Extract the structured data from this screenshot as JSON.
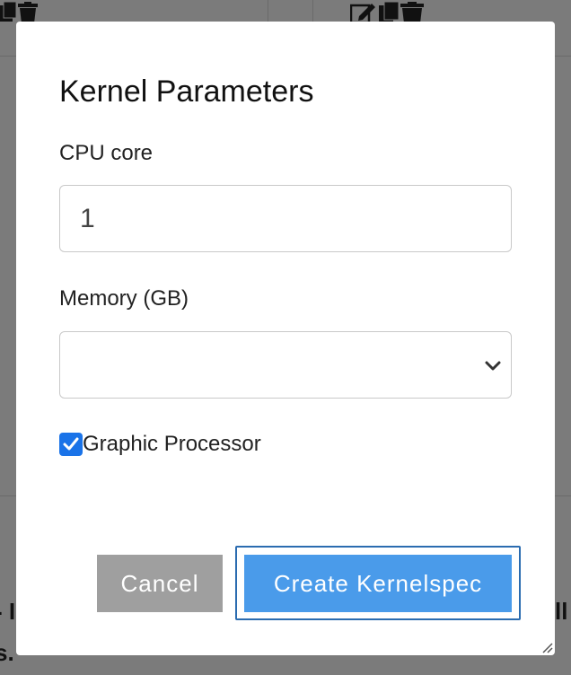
{
  "background": {
    "fragment_left": "- I",
    "fragment_left_2": "s.",
    "fragment_right": "ll"
  },
  "modal": {
    "title": "Kernel Parameters",
    "cpu": {
      "label": "CPU core",
      "value": "1"
    },
    "memory": {
      "label": "Memory (GB)",
      "selected": ""
    },
    "gpu": {
      "label": "Graphic Processor",
      "checked": true
    },
    "buttons": {
      "cancel": "Cancel",
      "create": "Create Kernelspec"
    }
  },
  "colors": {
    "primary": "#4a9bea",
    "cancel": "#9f9f9f",
    "checkbox": "#1a73e8",
    "overlay": "#7b7b7b"
  },
  "icons": [
    "copy-icon",
    "trash-icon",
    "edit-icon"
  ]
}
